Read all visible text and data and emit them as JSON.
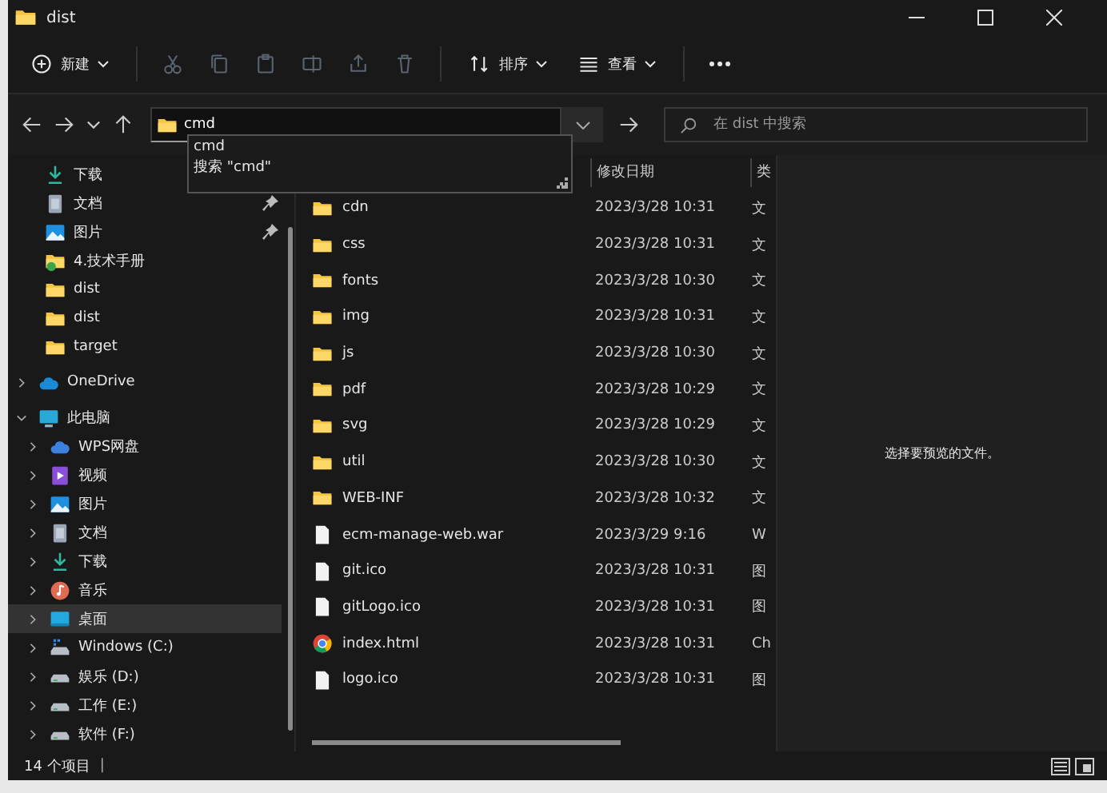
{
  "window": {
    "title": "dist"
  },
  "toolbar": [
    {
      "kind": "new",
      "label": "新建",
      "disabled": false
    },
    {
      "kind": "cut",
      "disabled": true
    },
    {
      "kind": "copy",
      "disabled": true
    },
    {
      "kind": "paste",
      "disabled": true
    },
    {
      "kind": "rename",
      "disabled": true
    },
    {
      "kind": "share",
      "disabled": true
    },
    {
      "kind": "delete",
      "disabled": true
    },
    {
      "kind": "sort",
      "label": "排序",
      "disabled": false
    },
    {
      "kind": "view",
      "label": "查看",
      "disabled": false
    },
    {
      "kind": "more",
      "disabled": false
    }
  ],
  "address": {
    "value": "cmd",
    "suggestions": [
      "cmd",
      "搜索 \"cmd\""
    ]
  },
  "search": {
    "placeholder": "在 dist 中搜索"
  },
  "sidebar": {
    "items": [
      {
        "kind": "download",
        "label": "下载",
        "pinned": false
      },
      {
        "kind": "document",
        "label": "文档",
        "pinned": true
      },
      {
        "kind": "picture",
        "label": "图片",
        "pinned": true
      },
      {
        "kind": "synced",
        "label": "4.技术手册",
        "pinned": false
      },
      {
        "kind": "folder",
        "label": "dist",
        "pinned": false
      },
      {
        "kind": "folder",
        "label": "dist",
        "pinned": false
      },
      {
        "kind": "folder",
        "label": "target",
        "pinned": false
      }
    ],
    "tree": [
      {
        "kind": "cloud",
        "label": "OneDrive",
        "expanded": false,
        "selected": false
      },
      {
        "kind": "pc",
        "label": "此电脑",
        "expanded": true,
        "selected": false,
        "children": [
          {
            "kind": "wps",
            "label": "WPS网盘",
            "expanded": false,
            "selected": false
          },
          {
            "kind": "video",
            "label": "视频",
            "expanded": false,
            "selected": false
          },
          {
            "kind": "picture",
            "label": "图片",
            "expanded": false,
            "selected": false
          },
          {
            "kind": "document",
            "label": "文档",
            "expanded": false,
            "selected": false
          },
          {
            "kind": "download",
            "label": "下载",
            "expanded": false,
            "selected": false
          },
          {
            "kind": "music",
            "label": "音乐",
            "expanded": false,
            "selected": false
          },
          {
            "kind": "desktop",
            "label": "桌面",
            "expanded": false,
            "selected": true
          },
          {
            "kind": "sysdrive",
            "label": "Windows (C:)",
            "expanded": false,
            "selected": false
          },
          {
            "kind": "drive",
            "label": "娱乐 (D:)",
            "expanded": false,
            "selected": false
          },
          {
            "kind": "drive",
            "label": "工作 (E:)",
            "expanded": false,
            "selected": false
          },
          {
            "kind": "drive",
            "label": "软件 (F:)",
            "expanded": false,
            "selected": false
          }
        ]
      }
    ]
  },
  "table": {
    "columns": [
      "修改日期",
      "类"
    ],
    "rows": [
      {
        "kind": "folder",
        "name": "cdn",
        "modified": "2023/3/28 10:31",
        "type": "文"
      },
      {
        "kind": "folder",
        "name": "css",
        "modified": "2023/3/28 10:31",
        "type": "文"
      },
      {
        "kind": "folder",
        "name": "fonts",
        "modified": "2023/3/28 10:30",
        "type": "文"
      },
      {
        "kind": "folder",
        "name": "img",
        "modified": "2023/3/28 10:31",
        "type": "文"
      },
      {
        "kind": "folder",
        "name": "js",
        "modified": "2023/3/28 10:30",
        "type": "文"
      },
      {
        "kind": "folder",
        "name": "pdf",
        "modified": "2023/3/28 10:29",
        "type": "文"
      },
      {
        "kind": "folder",
        "name": "svg",
        "modified": "2023/3/28 10:29",
        "type": "文"
      },
      {
        "kind": "folder",
        "name": "util",
        "modified": "2023/3/28 10:30",
        "type": "文"
      },
      {
        "kind": "folder",
        "name": "WEB-INF",
        "modified": "2023/3/28 10:32",
        "type": "文"
      },
      {
        "kind": "file",
        "name": "ecm-manage-web.war",
        "modified": "2023/3/29 9:16",
        "type": "W"
      },
      {
        "kind": "file",
        "name": "git.ico",
        "modified": "2023/3/28 10:31",
        "type": "图"
      },
      {
        "kind": "file",
        "name": "gitLogo.ico",
        "modified": "2023/3/28 10:31",
        "type": "图"
      },
      {
        "kind": "chrome",
        "name": "index.html",
        "modified": "2023/3/28 10:31",
        "type": "Ch"
      },
      {
        "kind": "file",
        "name": "logo.ico",
        "modified": "2023/3/28 10:31",
        "type": "图"
      }
    ]
  },
  "preview": {
    "message": "选择要预览的文件。"
  },
  "status_bar": {
    "count": "14 个项目",
    "separator": "|"
  }
}
